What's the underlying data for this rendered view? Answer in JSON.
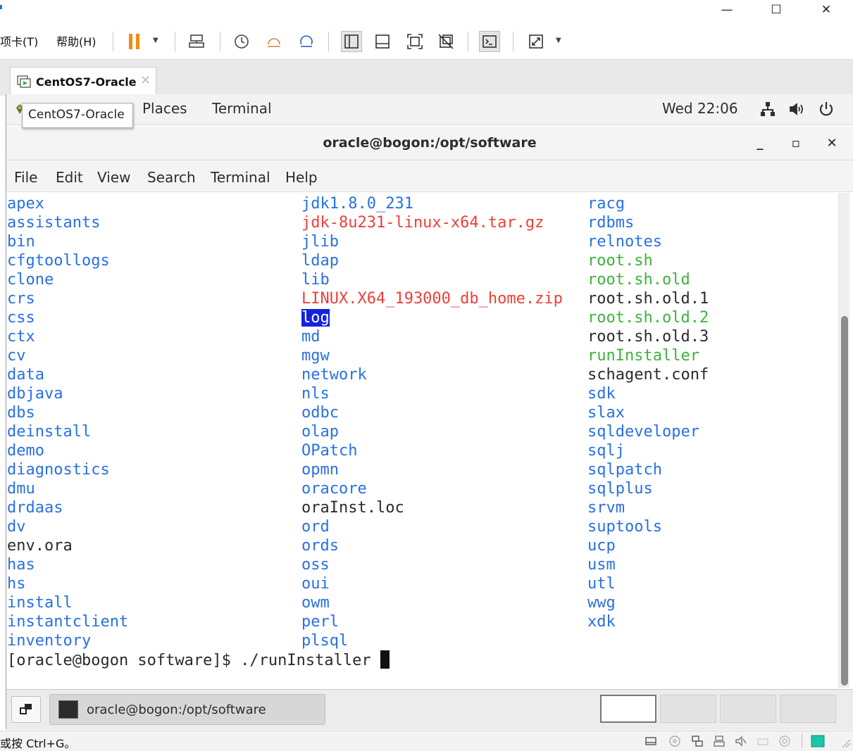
{
  "host": {
    "menu_tabs_label": "项卡(T)",
    "menu_help_label": "帮助(H)",
    "vm_tab_label": "CentOS7-Oracle",
    "tooltip": "CentOS7-Oracle",
    "status_text": "或按 Ctrl+G。",
    "window_controls": {
      "minimize": "—",
      "maximize": "☐",
      "close": "✕"
    }
  },
  "gnome": {
    "places_label": "Places",
    "terminal_label": "Terminal",
    "clock": "Wed 22:06"
  },
  "terminal": {
    "title": "oracle@bogon:/opt/software",
    "buttons": {
      "minimize": "_",
      "maximize": "▫",
      "close": "✕"
    },
    "menu": [
      "File",
      "Edit",
      "View",
      "Search",
      "Terminal",
      "Help"
    ],
    "columns": [
      [
        {
          "name": "apex",
          "type": "dir"
        },
        {
          "name": "assistants",
          "type": "dir"
        },
        {
          "name": "bin",
          "type": "dir"
        },
        {
          "name": "cfgtoollogs",
          "type": "dir"
        },
        {
          "name": "clone",
          "type": "dir"
        },
        {
          "name": "crs",
          "type": "dir"
        },
        {
          "name": "css",
          "type": "dir"
        },
        {
          "name": "ctx",
          "type": "dir"
        },
        {
          "name": "cv",
          "type": "dir"
        },
        {
          "name": "data",
          "type": "dir"
        },
        {
          "name": "dbjava",
          "type": "dir"
        },
        {
          "name": "dbs",
          "type": "dir"
        },
        {
          "name": "deinstall",
          "type": "dir"
        },
        {
          "name": "demo",
          "type": "dir"
        },
        {
          "name": "diagnostics",
          "type": "dir"
        },
        {
          "name": "dmu",
          "type": "dir"
        },
        {
          "name": "drdaas",
          "type": "dir"
        },
        {
          "name": "dv",
          "type": "dir"
        },
        {
          "name": "env.ora",
          "type": "file"
        },
        {
          "name": "has",
          "type": "dir"
        },
        {
          "name": "hs",
          "type": "dir"
        },
        {
          "name": "install",
          "type": "dir"
        },
        {
          "name": "instantclient",
          "type": "dir"
        },
        {
          "name": "inventory",
          "type": "dir"
        }
      ],
      [
        {
          "name": "jdk1.8.0_231",
          "type": "dir"
        },
        {
          "name": "jdk-8u231-linux-x64.tar.gz",
          "type": "archive"
        },
        {
          "name": "jlib",
          "type": "dir"
        },
        {
          "name": "ldap",
          "type": "dir"
        },
        {
          "name": "lib",
          "type": "dir"
        },
        {
          "name": "LINUX.X64_193000_db_home.zip",
          "type": "archive"
        },
        {
          "name": "log",
          "type": "selected"
        },
        {
          "name": "md",
          "type": "dir"
        },
        {
          "name": "mgw",
          "type": "dir"
        },
        {
          "name": "network",
          "type": "dir"
        },
        {
          "name": "nls",
          "type": "dir"
        },
        {
          "name": "odbc",
          "type": "dir"
        },
        {
          "name": "olap",
          "type": "dir"
        },
        {
          "name": "OPatch",
          "type": "dir"
        },
        {
          "name": "opmn",
          "type": "dir"
        },
        {
          "name": "oracore",
          "type": "dir"
        },
        {
          "name": "oraInst.loc",
          "type": "file"
        },
        {
          "name": "ord",
          "type": "dir"
        },
        {
          "name": "ords",
          "type": "dir"
        },
        {
          "name": "oss",
          "type": "dir"
        },
        {
          "name": "oui",
          "type": "dir"
        },
        {
          "name": "owm",
          "type": "dir"
        },
        {
          "name": "perl",
          "type": "dir"
        },
        {
          "name": "plsql",
          "type": "dir"
        }
      ],
      [
        {
          "name": "racg",
          "type": "dir"
        },
        {
          "name": "rdbms",
          "type": "dir"
        },
        {
          "name": "relnotes",
          "type": "dir"
        },
        {
          "name": "root.sh",
          "type": "exec"
        },
        {
          "name": "root.sh.old",
          "type": "exec"
        },
        {
          "name": "root.sh.old.1",
          "type": "file"
        },
        {
          "name": "root.sh.old.2",
          "type": "exec"
        },
        {
          "name": "root.sh.old.3",
          "type": "file"
        },
        {
          "name": "runInstaller",
          "type": "exec"
        },
        {
          "name": "schagent.conf",
          "type": "file"
        },
        {
          "name": "sdk",
          "type": "dir"
        },
        {
          "name": "slax",
          "type": "dir"
        },
        {
          "name": "sqldeveloper",
          "type": "dir"
        },
        {
          "name": "sqlj",
          "type": "dir"
        },
        {
          "name": "sqlpatch",
          "type": "dir"
        },
        {
          "name": "sqlplus",
          "type": "dir"
        },
        {
          "name": "srvm",
          "type": "dir"
        },
        {
          "name": "suptools",
          "type": "dir"
        },
        {
          "name": "ucp",
          "type": "dir"
        },
        {
          "name": "usm",
          "type": "dir"
        },
        {
          "name": "utl",
          "type": "dir"
        },
        {
          "name": "wwg",
          "type": "dir"
        },
        {
          "name": "xdk",
          "type": "dir"
        }
      ]
    ],
    "prompt": "[oracle@bogon software]$ ./runInstaller "
  },
  "taskbar": {
    "window_label": "oracle@bogon:/opt/software"
  },
  "colors": {
    "dir": "#2870e4",
    "archive": "#ee3f3a",
    "exec": "#3eb23a",
    "file": "#2b2b2b",
    "selection": "#1322e0"
  }
}
